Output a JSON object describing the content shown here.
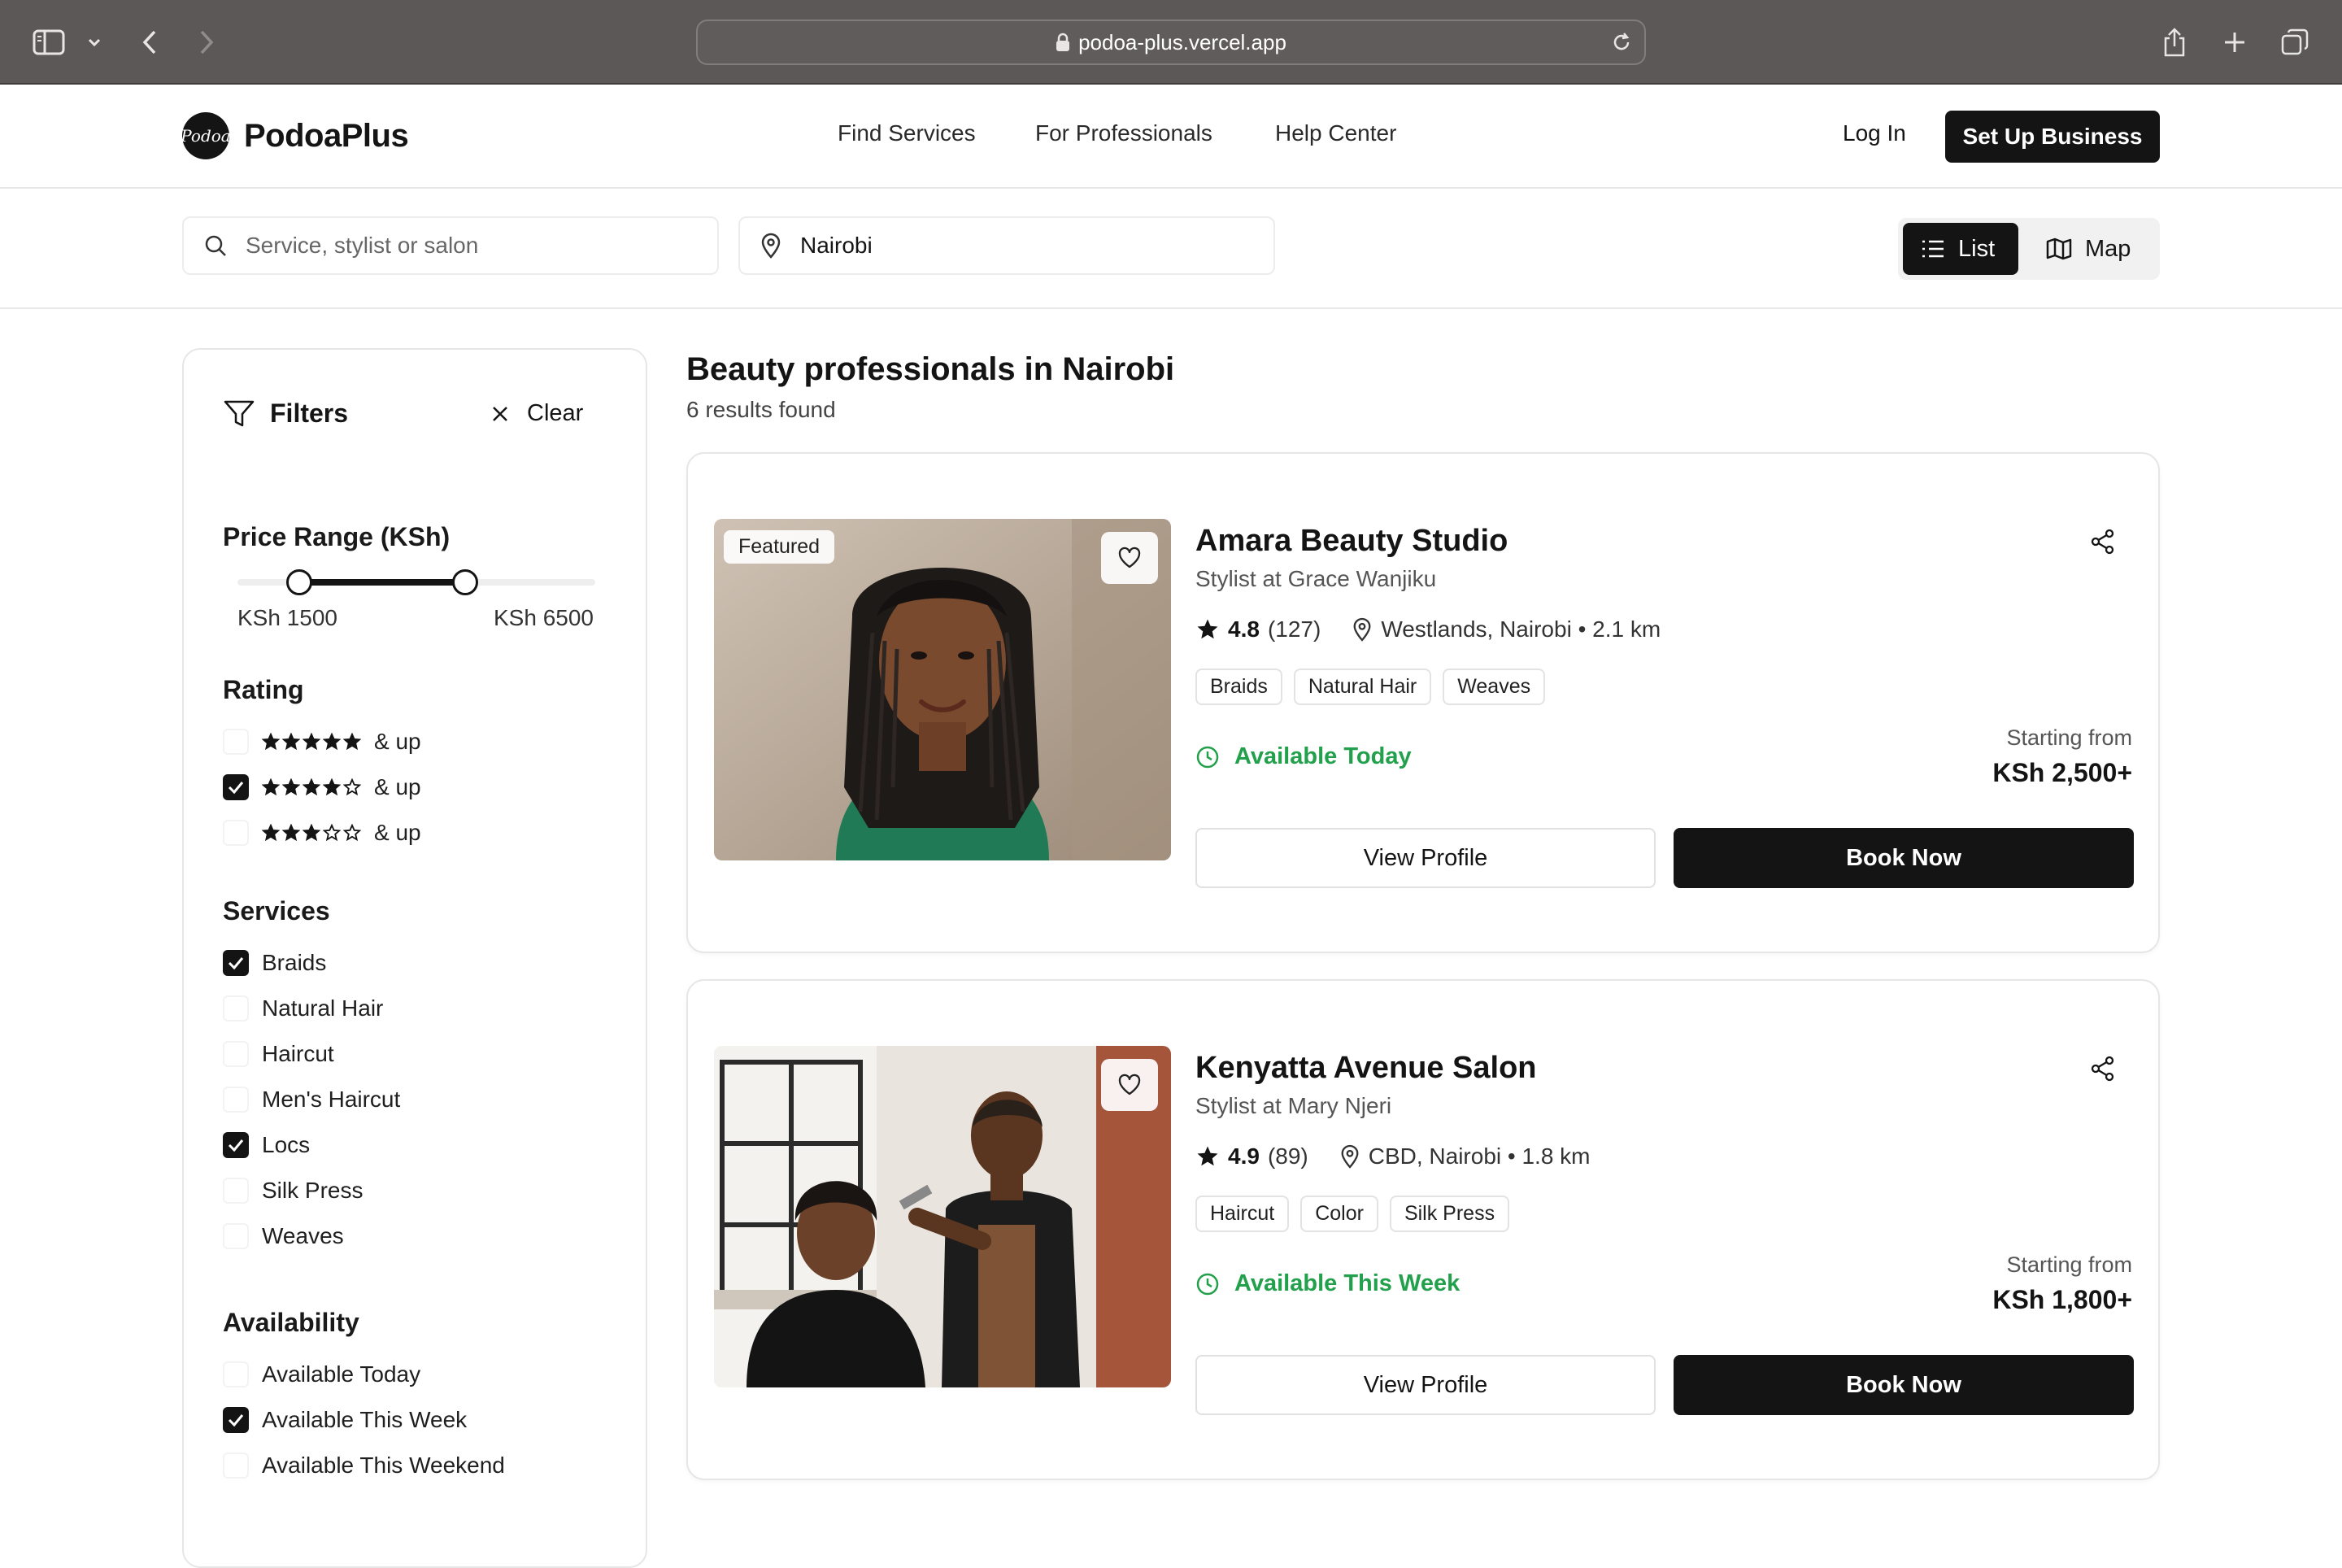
{
  "browser": {
    "url": "podoa-plus.vercel.app"
  },
  "header": {
    "brand": "PodoaPlus",
    "logo_mark": "Podoa",
    "nav": [
      "Find Services",
      "For Professionals",
      "Help Center"
    ],
    "login": "Log In",
    "cta": "Set Up Business"
  },
  "search": {
    "query_placeholder": "Service, stylist or salon",
    "location": "Nairobi",
    "view_list": "List",
    "view_map": "Map",
    "active_view": "List"
  },
  "filters": {
    "title": "Filters",
    "clear": "Clear",
    "price": {
      "title": "Price Range (KSh)",
      "min_label": "KSh 1500",
      "max_label": "KSh 6500",
      "selected_fraction_start": 0.17,
      "selected_fraction_end": 0.64
    },
    "rating": {
      "title": "Rating",
      "options": [
        {
          "stars": 5,
          "label": "& up",
          "checked": false
        },
        {
          "stars": 4,
          "label": "& up",
          "checked": true
        },
        {
          "stars": 3,
          "label": "& up",
          "checked": false
        }
      ]
    },
    "services": {
      "title": "Services",
      "options": [
        {
          "label": "Braids",
          "checked": true
        },
        {
          "label": "Natural Hair",
          "checked": false
        },
        {
          "label": "Haircut",
          "checked": false
        },
        {
          "label": "Men's Haircut",
          "checked": false
        },
        {
          "label": "Locs",
          "checked": true
        },
        {
          "label": "Silk Press",
          "checked": false
        },
        {
          "label": "Weaves",
          "checked": false
        }
      ]
    },
    "availability": {
      "title": "Availability",
      "options": [
        {
          "label": "Available Today",
          "checked": false
        },
        {
          "label": "Available This Week",
          "checked": true
        },
        {
          "label": "Available This Weekend",
          "checked": false
        }
      ]
    }
  },
  "results": {
    "title": "Beauty professionals in Nairobi",
    "count": "6 results found",
    "cards": [
      {
        "badge": "Featured",
        "name": "Amara Beauty Studio",
        "subtitle": "Stylist at Grace Wanjiku",
        "rating": "4.8",
        "reviews": "(127)",
        "location": "Westlands, Nairobi • 2.1 km",
        "tags": [
          "Braids",
          "Natural Hair",
          "Weaves"
        ],
        "availability": "Available Today",
        "price_label": "Starting from",
        "price": "KSh 2,500+",
        "view": "View Profile",
        "book": "Book Now"
      },
      {
        "badge": "",
        "name": "Kenyatta Avenue Salon",
        "subtitle": "Stylist at Mary Njeri",
        "rating": "4.9",
        "reviews": "(89)",
        "location": "CBD, Nairobi • 1.8 km",
        "tags": [
          "Haircut",
          "Color",
          "Silk Press"
        ],
        "availability": "Available This Week",
        "price_label": "Starting from",
        "price": "KSh 1,800+",
        "view": "View Profile",
        "book": "Book Now"
      }
    ]
  },
  "colors": {
    "accent": "#141414",
    "available": "#22a04c",
    "chrome": "#5b5857"
  }
}
